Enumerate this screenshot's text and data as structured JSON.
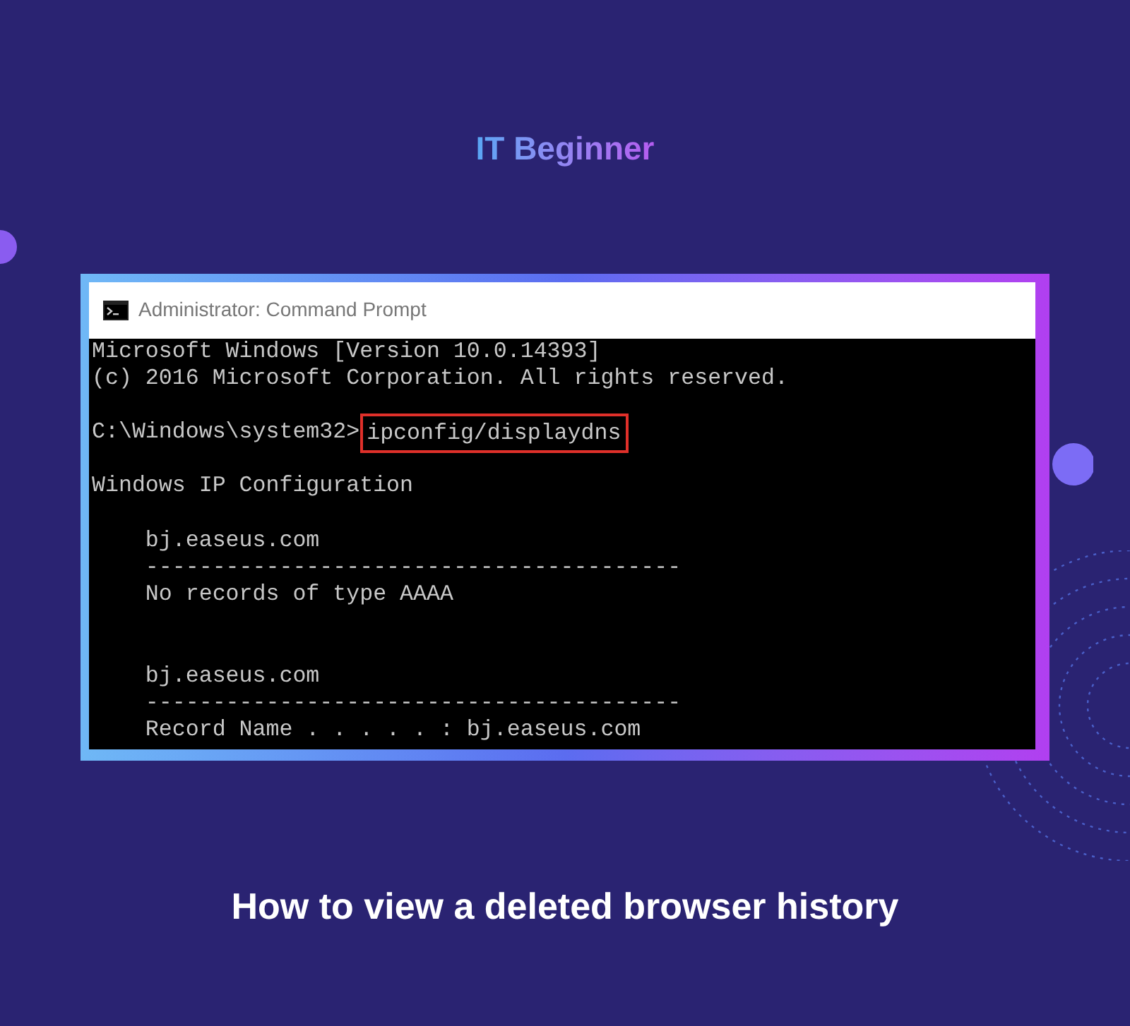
{
  "heading": "IT Beginner",
  "window": {
    "title": "Administrator: Command Prompt"
  },
  "terminal": {
    "lines": [
      {
        "kind": "text",
        "text": "Microsoft Windows [Version 10.0.14393]"
      },
      {
        "kind": "text",
        "text": "(c) 2016 Microsoft Corporation. All rights reserved."
      },
      {
        "kind": "blank"
      },
      {
        "kind": "prompt",
        "prompt": "C:\\Windows\\system32>",
        "command": "ipconfig/displaydns",
        "highlighted": true
      },
      {
        "kind": "blank"
      },
      {
        "kind": "text",
        "text": "Windows IP Configuration"
      },
      {
        "kind": "blank"
      },
      {
        "kind": "text",
        "text": "    bj.easeus.com"
      },
      {
        "kind": "text",
        "text": "    ----------------------------------------"
      },
      {
        "kind": "text",
        "text": "    No records of type AAAA"
      },
      {
        "kind": "blank"
      },
      {
        "kind": "blank"
      },
      {
        "kind": "text",
        "text": "    bj.easeus.com"
      },
      {
        "kind": "text",
        "text": "    ----------------------------------------"
      },
      {
        "kind": "text",
        "text": "    Record Name . . . . . : bj.easeus.com"
      }
    ]
  },
  "caption": "How to view a deleted browser history"
}
